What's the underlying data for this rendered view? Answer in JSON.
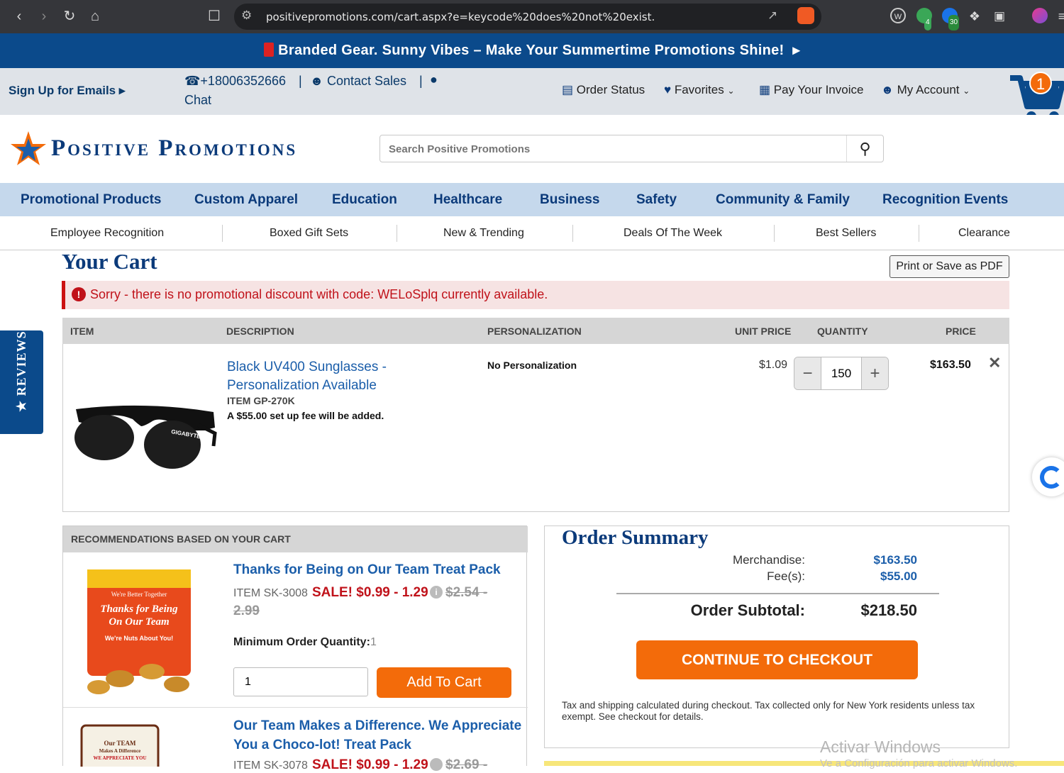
{
  "browser": {
    "url": "positivepromotions.com/cart.aspx?e=keycode%20does%20not%20exist.",
    "ext_badge_1": "4",
    "ext_badge_2": "30"
  },
  "promo_banner": {
    "text": "Branded Gear. Sunny Vibes – Make Your Summertime Promotions Shine!"
  },
  "utility": {
    "sign_up": "Sign Up for Emails",
    "phone": "+18006352666",
    "contact_sales": "Contact Sales",
    "chat": "Chat",
    "order_status": "Order Status",
    "favorites": "Favorites",
    "pay_invoice": "Pay Your Invoice",
    "my_account": "My Account",
    "cart_count": "1"
  },
  "logo": {
    "text": "Positive Promotions"
  },
  "search": {
    "placeholder": "Search Positive Promotions"
  },
  "main_nav": [
    "Promotional Products",
    "Custom Apparel",
    "Education",
    "Healthcare",
    "Business",
    "Safety",
    "Community & Family",
    "Recognition Events"
  ],
  "sub_nav": [
    "Employee Recognition",
    "Boxed Gift Sets",
    "New & Trending",
    "Deals Of The Week",
    "Best Sellers",
    "Clearance"
  ],
  "cart": {
    "title": "Your Cart",
    "print_label": "Print or Save as PDF",
    "alert": "Sorry - there is no promotional discount with code: WELoSplq currently available.",
    "headers": {
      "item": "ITEM",
      "description": "DESCRIPTION",
      "personalization": "PERSONALIZATION",
      "unit_price": "UNIT PRICE",
      "quantity": "QUANTITY",
      "price": "PRICE"
    },
    "line": {
      "name_1": "Black UV400 Sunglasses -",
      "name_2": "Personalization Available",
      "item_no": "ITEM GP-270K",
      "setup_fee": "A $55.00 set up fee will be added.",
      "personalization": "No Personalization",
      "unit_price": "$1.09",
      "quantity": "150",
      "price": "$163.50",
      "brand_print": "GIGABYTE"
    }
  },
  "recommendations": {
    "header": "RECOMMENDATIONS BASED ON YOUR CART",
    "items": [
      {
        "name": "Thanks for Being on Our Team Treat Pack",
        "item_no": "ITEM SK-3008",
        "sale": "SALE! $0.99 - 1.29",
        "old_price_1": "$2.54 -",
        "old_price_2": "2.99",
        "min_label": "Minimum Order Quantity:",
        "min_value": "1",
        "qty": "1",
        "add_label": "Add To Cart",
        "pkg_top": "We're Better Together",
        "pkg_main_1": "Thanks for Being",
        "pkg_main_2": "On Our Team",
        "pkg_sub": "We're Nuts About You!"
      },
      {
        "name_1": "Our Team Makes a Difference. We Appreciate",
        "name_2": "You a Choco-lot! Treat Pack",
        "item_no": "ITEM SK-3078",
        "sale": "SALE! $0.99 - 1.29",
        "old_price": "$2.69 -",
        "pkg_1": "Our TEAM",
        "pkg_2": "Makes A Difference",
        "pkg_3": "WE APPRECIATE YOU"
      }
    ]
  },
  "summary": {
    "title": "Order Summary",
    "merch_label": "Merchandise:",
    "merch_value": "$163.50",
    "fee_label": "Fee(s):",
    "fee_value": "$55.00",
    "subtotal_label": "Order Subtotal:",
    "subtotal_value": "$218.50",
    "checkout_label": "CONTINUE TO CHECKOUT",
    "note": "Tax and shipping calculated during checkout. Tax collected only for New York residents unless tax exempt. See checkout for details."
  },
  "reviews_tab": "REVIEWS",
  "watermark": {
    "line1": "Activar Windows",
    "line2": "Ve a Configuración para activar Windows."
  },
  "colors": {
    "navy": "#0b4a8b",
    "orange": "#f36b0a",
    "sale_red": "#c0121a",
    "link_blue": "#1b5eaa"
  }
}
